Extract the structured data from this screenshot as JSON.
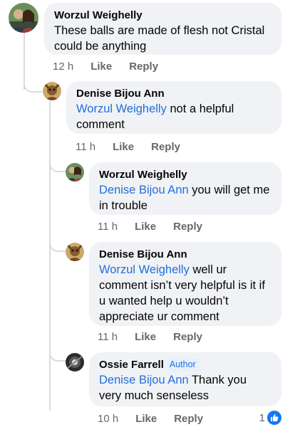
{
  "comments": [
    {
      "author": "Worzul Weighelly",
      "mention": "",
      "text": "These balls are made of flesh not Cristal could be anything",
      "time": "12 h",
      "like_label": "Like",
      "reply_label": "Reply"
    },
    {
      "author": "Denise Bijou Ann",
      "mention": "Worzul Weighelly",
      "text": " not a helpful comment",
      "time": "11 h",
      "like_label": "Like",
      "reply_label": "Reply"
    },
    {
      "author": "Worzul Weighelly",
      "mention": "Denise Bijou Ann",
      "text": " you will get me in trouble",
      "time": "11 h",
      "like_label": "Like",
      "reply_label": "Reply"
    },
    {
      "author": "Denise Bijou Ann",
      "mention": "Worzul Weighelly",
      "text": " well ur comment isn’t very helpful is it if u wanted help u wouldn’t appreciate ur comment",
      "time": "11 h",
      "like_label": "Like",
      "reply_label": "Reply"
    },
    {
      "author": "Ossie Farrell",
      "badge": "Author",
      "mention": "Denise Bijou Ann",
      "text": " Thank you very much senseless",
      "time": "10 h",
      "like_label": "Like",
      "reply_label": "Reply",
      "reaction_count": "1"
    }
  ],
  "colors": {
    "bubble": "#f0f2f5",
    "mention": "#216fdb",
    "meta": "#65676b",
    "like_badge": "#1877f2"
  }
}
